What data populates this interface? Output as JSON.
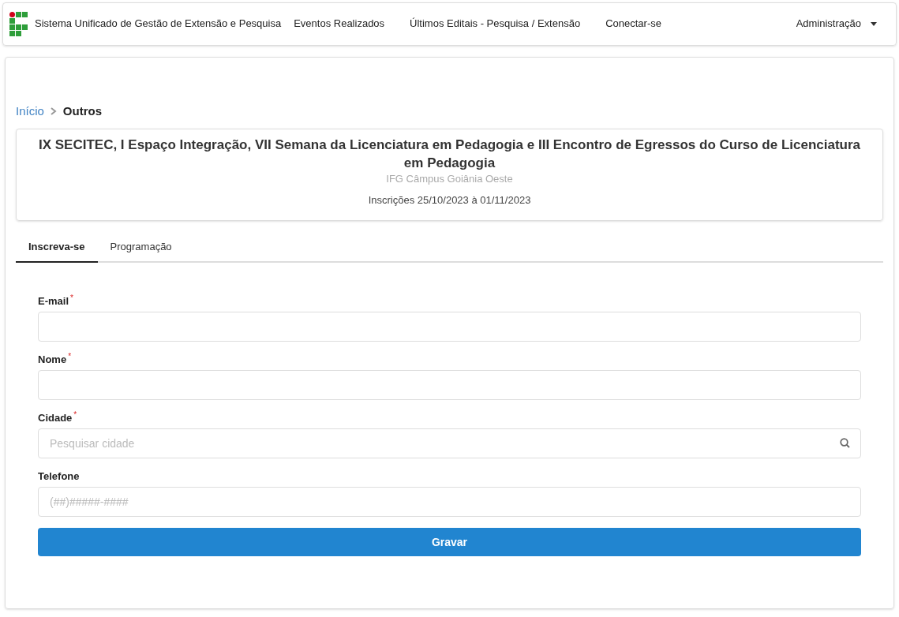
{
  "navbar": {
    "brand": "Sistema Unificado de Gestão de Extensão e Pesquisa",
    "links": [
      "Eventos Realizados",
      "Últimos Editais - Pesquisa / Extensão",
      "Conectar-se"
    ],
    "menu": "Administração"
  },
  "breadcrumb": [
    "Início",
    "Outros"
  ],
  "event": {
    "title": "IX SECITEC, I Espaço Integração, VII Semana da Licenciatura em Pedagogia e III Encontro de Egressos do Curso de Licenciatura em Pedagogia",
    "campus": "IFG Câmpus Goiânia Oeste",
    "dates": "Inscrições 25/10/2023 à 01/11/2023"
  },
  "tabs": [
    {
      "label": "Inscreva-se",
      "selected": true
    },
    {
      "label": "Programação",
      "selected": false
    }
  ],
  "fields": [
    {
      "kind": "text",
      "label": "E-mail",
      "required_mark": "*"
    },
    {
      "kind": "text",
      "label": "Nome",
      "required_mark": "*"
    },
    {
      "kind": "search",
      "label": "Cidade",
      "required_mark": "*",
      "placeholder": "Pesquisar cidade"
    },
    {
      "kind": "text",
      "label": "Telefone",
      "placeholder": "(##)#####-####"
    }
  ],
  "submit": "Gravar"
}
